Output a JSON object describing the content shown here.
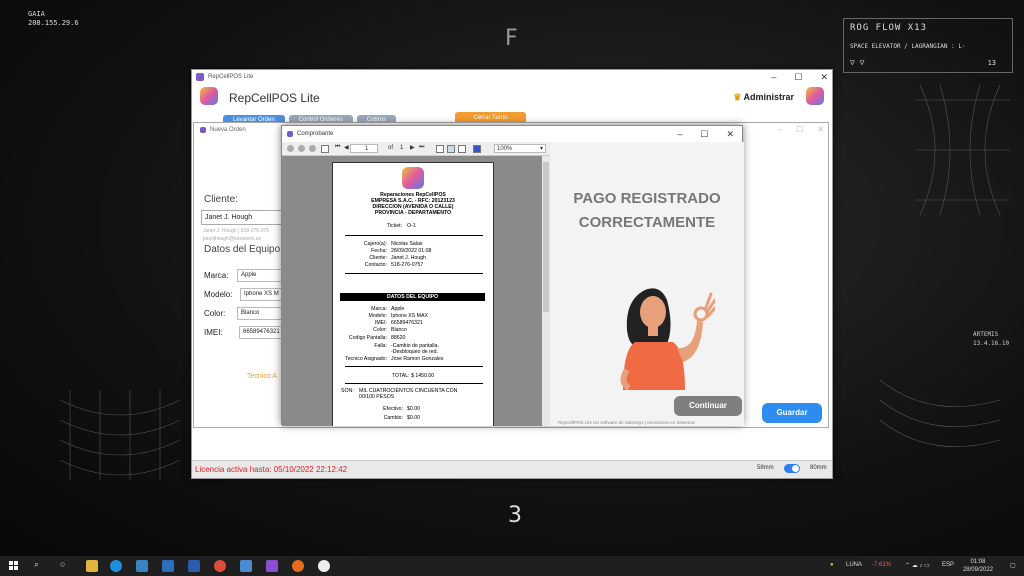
{
  "desktop": {
    "top_left_name": "GAIA",
    "top_left_ip": "208.155.29.6",
    "center_letter": "F",
    "bottom_number": "3",
    "rog_title": "ROG FLOW X13",
    "rog_subtitle": "SPACE ELEVATOR / LAGRANGIAN : L·",
    "rog_number": "13",
    "artemis_name": "ARTEMIS",
    "artemis_version": "13.4.16.10"
  },
  "main_window": {
    "title": "RepCellPOS Lite",
    "app_title": "RepCellPOS Lite",
    "user": "Administrar",
    "tabs": [
      "Levantar Orden",
      "Control Ordenes",
      "Cobros"
    ],
    "turno_button": "Cerrar Turno",
    "licencia": "Licencia activa hasta: 05/10/2022 22:12:42",
    "toggle_left": "58mm",
    "toggle_right": "80mm"
  },
  "nueva_orden": {
    "title": "Nueva Orden",
    "cliente_label": "Cliente:",
    "cliente_value": "Janet J. Hough",
    "cliente_info_1": "Janet J. Hough | 518-276-075",
    "cliente_info_2": "janetjhough@teleworm.us",
    "datos_label": "Datos del Equipo",
    "marca_label": "Marca:",
    "marca_value": "Apple",
    "modelo_label": "Modelo:",
    "modelo_value": "Iphone XS M",
    "color_label": "Color:",
    "color_value": "Blanco",
    "imei_label": "IMEI:",
    "imei_value": "66589476321",
    "tecnico_label": "Tecnico A",
    "guardar_button": "Guardar"
  },
  "comprobante": {
    "title": "Comprobante",
    "page_current": "1",
    "page_of": "of",
    "page_total": "1",
    "zoom": "100%",
    "receipt": {
      "business": "Reparaciones RepCellPOS",
      "company": "EMPRESA S.A.C. - RFC: 20123123",
      "address": "DIRECCION (AVENIDA O CALLE)",
      "province": "PROVINCIA - DEPARTAMENTO",
      "ticket_label": "Ticket:",
      "ticket_value": "O-1",
      "cajero_label": "Cajero(a):",
      "cajero_value": "Nicolas Salas",
      "fecha_label": "Fecha:",
      "fecha_value": "28/09/2022 01:08",
      "cliente_label": "Cliente:",
      "cliente_value": "Janet J. Hough",
      "contacto_label": "Contacto:",
      "contacto_value": "518-276-0757",
      "section_title": "DATOS DEL EQUIPO",
      "marca_label": "Marca:",
      "marca_value": "Apple",
      "modelo_label": "Modelo:",
      "modelo_value": "Iphone XS MAX",
      "imei_label": "IMEI:",
      "imei_value": "66589476321",
      "color_label": "Color:",
      "color_value": "Blanco",
      "codigo_label": "Codigo Pantalla:",
      "codigo_value": "88620",
      "falla_label": "Falla:",
      "falla_value_1": "-Cambio de pantalla.",
      "falla_value_2": "-Desbloqueo de red.",
      "tecnico_label": "Tecnico Asignado:",
      "tecnico_value": "Jose Ramon Gonzales",
      "total": "TOTAL: $ 1450.00",
      "son_label": "SON:",
      "son_value_1": "MIL CUATROCIENTOS CINCUENTA CON",
      "son_value_2": "00/100 PESOS",
      "efectivo_label": "Efectivo:",
      "efectivo_value": "$0.00",
      "cambio_label": "Cambio:",
      "cambio_value": "$0.00"
    },
    "message_line1": "PAGO REGISTRADO",
    "message_line2": "CORRECTAMENTE",
    "continuar_button": "Continuar",
    "footnote": "RepCellPOS Lite Un software de SalasSys | Innovacion en Sistemas"
  },
  "taskbar": {
    "weather": "LUNA",
    "stock_change": "-7.61%",
    "lang": "ESP",
    "time": "01:08",
    "date": "28/09/2022"
  },
  "colors": {
    "accent_blue": "#2d8cf0",
    "accent_orange": "#f39c32",
    "license_red": "#e02020",
    "stock_red": "#ff5555"
  }
}
